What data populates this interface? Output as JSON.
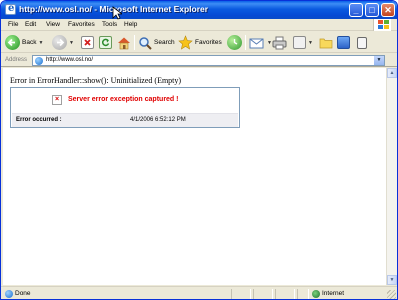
{
  "window": {
    "title": "http://www.osl.no/ - Microsoft Internet Explorer",
    "controls": {
      "minimize": "_",
      "maximize": "□",
      "close": "✕"
    }
  },
  "menu": [
    "File",
    "Edit",
    "View",
    "Favorites",
    "Tools",
    "Help"
  ],
  "toolbar": {
    "back_label": "Back",
    "search_label": "Search",
    "favorites_label": "Favorites"
  },
  "address": {
    "label": "Address",
    "url": "http://www.osl.no/"
  },
  "page": {
    "error_line": "Error in ErrorHandler::show(): Uninitialized (Empty)",
    "box_title": "Server error exception captured !",
    "occurred_label": "Error occurred :",
    "occurred_time": "4/1/2006 6:52:12 PM"
  },
  "status": {
    "text": "Done",
    "zone": "Internet"
  },
  "colors": {
    "titlebar": "#0a5ae0",
    "error_red": "#e00000",
    "chrome": "#ece9d8"
  },
  "icons": [
    "ie-logo-icon",
    "back-arrow-icon",
    "forward-arrow-icon",
    "stop-icon",
    "refresh-icon",
    "home-icon",
    "search-icon",
    "favorites-star-icon",
    "history-icon",
    "mail-icon",
    "print-icon",
    "edit-icon",
    "folder-icon",
    "messenger-icon",
    "research-icon",
    "windows-flag-icon",
    "page-icon",
    "error-x-icon",
    "internet-zone-icon"
  ]
}
